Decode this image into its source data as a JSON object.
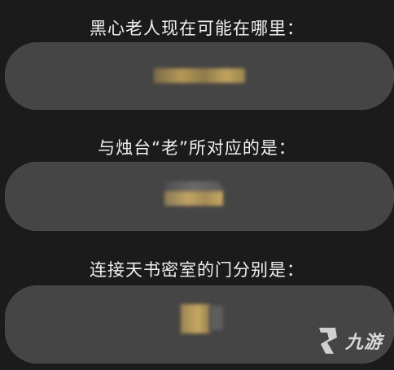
{
  "questions": [
    {
      "text": "黑心老人现在可能在哪里："
    },
    {
      "text": "与烛台“老”所对应的是："
    },
    {
      "text": "连接天书密室的门分别是："
    }
  ],
  "watermark": {
    "text": "九游",
    "logo": "9-logo-icon"
  },
  "colors": {
    "background": "#1b1b1b",
    "pill": "#454545",
    "text": "#f0f0f0",
    "blur_gold": "#b59857"
  }
}
